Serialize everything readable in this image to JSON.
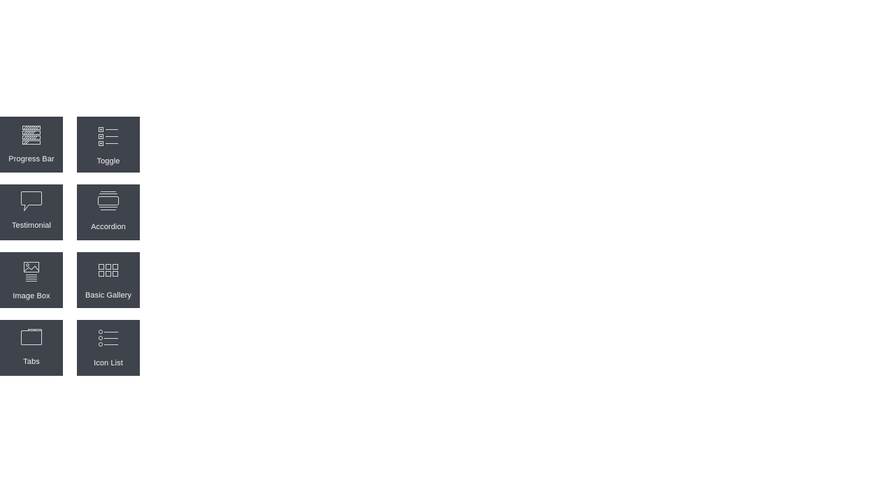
{
  "widgets": [
    {
      "label": "Progress Bar",
      "icon": "progress-bar-icon"
    },
    {
      "label": "Toggle",
      "icon": "toggle-icon"
    },
    {
      "label": "Testimonial",
      "icon": "testimonial-icon"
    },
    {
      "label": "Accordion",
      "icon": "accordion-icon"
    },
    {
      "label": "Image Box",
      "icon": "image-box-icon"
    },
    {
      "label": "Basic Gallery",
      "icon": "basic-gallery-icon"
    },
    {
      "label": "Tabs",
      "icon": "tabs-icon"
    },
    {
      "label": "Icon List",
      "icon": "icon-list-icon"
    }
  ],
  "colors": {
    "tile_background": "#3f434b",
    "label_text": "#f1f2f3",
    "icon_stroke": "#d7d9dc",
    "page_background": "#ffffff"
  }
}
